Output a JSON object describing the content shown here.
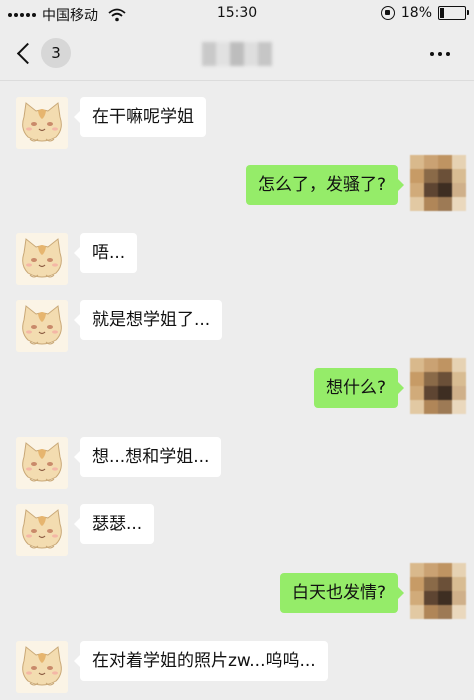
{
  "status_bar": {
    "carrier": "中国移动",
    "time": "15:30",
    "battery_percent": "18%",
    "battery_level": 0.18,
    "icons": [
      "signal-icon",
      "wifi-icon",
      "rotation-lock-icon",
      "battery-icon"
    ]
  },
  "nav": {
    "back_count": "3",
    "icons": [
      "chevron-left-icon",
      "more-icon"
    ]
  },
  "messages": [
    {
      "side": "in",
      "text": "在干嘛呢学姐"
    },
    {
      "side": "out",
      "text": "怎么了，发骚了?"
    },
    {
      "side": "in",
      "text": "唔..."
    },
    {
      "side": "in",
      "text": "就是想学姐了..."
    },
    {
      "side": "out",
      "text": "想什么?"
    },
    {
      "side": "in",
      "text": "想...想和学姐..."
    },
    {
      "side": "in",
      "text": "瑟瑟..."
    },
    {
      "side": "out",
      "text": "白天也发情?"
    },
    {
      "side": "in",
      "text": "在对着学姐的照片zw...呜呜..."
    }
  ],
  "colors": {
    "background": "#ededed",
    "incoming_bubble": "#ffffff",
    "outgoing_bubble": "#95ec69"
  }
}
